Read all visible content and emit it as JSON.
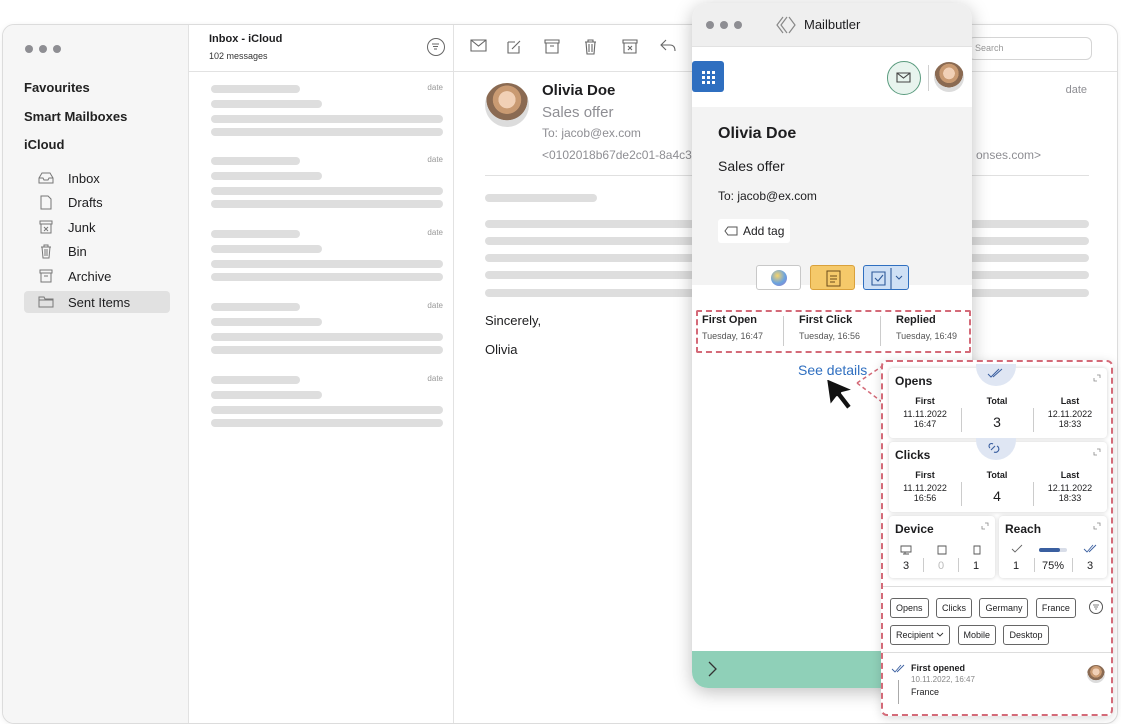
{
  "sidebar": {
    "sections": [
      "Favourites",
      "Smart Mailboxes",
      "iCloud"
    ],
    "items": [
      {
        "label": "Inbox",
        "icon": "inbox-tray-icon"
      },
      {
        "label": "Drafts",
        "icon": "draft-document-icon"
      },
      {
        "label": "Junk",
        "icon": "junk-bin-icon"
      },
      {
        "label": "Bin",
        "icon": "trash-icon"
      },
      {
        "label": "Archive",
        "icon": "archive-box-icon"
      },
      {
        "label": "Sent Items",
        "icon": "folder-icon",
        "selected": true
      }
    ]
  },
  "message_list": {
    "title": "Inbox - iCloud",
    "subtitle": "102 messages",
    "date_label": "date"
  },
  "search": {
    "placeholder": "Search"
  },
  "email": {
    "sender": "Olivia Doe",
    "subject": "Sales offer",
    "to": "To: jacob@ex.com",
    "message_id_start": "<0102018b67de2c01-8a4c3",
    "message_id_end": "onses.com>",
    "date": "date",
    "closing": "Sincerely,",
    "signature": "Olivia"
  },
  "mailbutler": {
    "title": "Mailbutler",
    "sender": "Olivia Doe",
    "subject": "Sales offer",
    "to": "To: jacob@ex.com",
    "add_tag": "Add tag",
    "tracking": [
      {
        "label": "First Open",
        "time": "Tuesday, 16:47"
      },
      {
        "label": "First Click",
        "time": "Tuesday, 16:56"
      },
      {
        "label": "Replied",
        "time": "Tuesday, 16:49"
      }
    ],
    "see_details": "See details"
  },
  "details": {
    "opens": {
      "title": "Opens",
      "first_label": "First",
      "first_date": "11.11.2022",
      "first_time": "16:47",
      "total_label": "Total",
      "total": "3",
      "last_label": "Last",
      "last_date": "12.11.2022",
      "last_time": "18:33"
    },
    "clicks": {
      "title": "Clicks",
      "first_label": "First",
      "first_date": "11.11.2022",
      "first_time": "16:56",
      "total_label": "Total",
      "total": "4",
      "last_label": "Last",
      "last_date": "12.11.2022",
      "last_time": "18:33"
    },
    "device": {
      "title": "Device",
      "desktop": "3",
      "tablet": "0",
      "mobile": "1"
    },
    "reach": {
      "title": "Reach",
      "sent": "1",
      "percent": "75%",
      "read": "3",
      "progress": 0.75
    },
    "filters_row1": [
      "Opens",
      "Clicks",
      "Germany",
      "France"
    ],
    "filters_row2": [
      "Recipient",
      "Mobile",
      "Desktop"
    ],
    "event": {
      "title": "First opened",
      "time": "10.11.2022, 16:47",
      "location": "France"
    }
  },
  "colors": {
    "accent": "#2f6fc0",
    "teal": "#8fd0b8",
    "dashed": "#d46a78",
    "yellow": "#f5c96a"
  }
}
